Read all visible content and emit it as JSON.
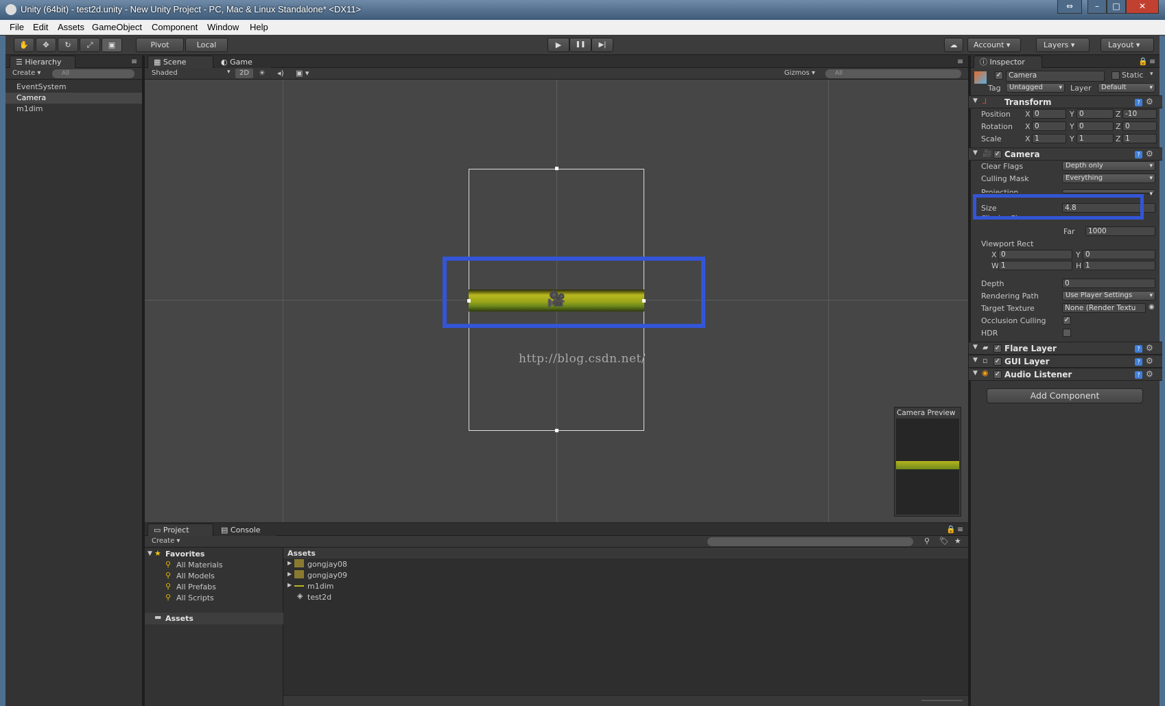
{
  "window": {
    "title": "Unity (64bit) - test2d.unity - New Unity Project - PC, Mac & Linux Standalone* <DX11>",
    "minimize": "–",
    "maximize": "□",
    "close": "✕",
    "restore": "⇔"
  },
  "menu": [
    "File",
    "Edit",
    "Assets",
    "GameObject",
    "Component",
    "Window",
    "Help"
  ],
  "toolbar": {
    "pivot": "Pivot",
    "local": "Local",
    "account": "Account",
    "layers": "Layers",
    "layout": "Layout",
    "play": "▶",
    "pause": "❚❚",
    "step": "▶|"
  },
  "hierarchy": {
    "tab": "Hierarchy",
    "create": "Create",
    "search": "All",
    "items": [
      "EventSystem",
      "Camera",
      "m1dim"
    ],
    "selected": "Camera"
  },
  "scene": {
    "tab_scene": "Scene",
    "tab_game": "Game",
    "shading": "Shaded",
    "mode_2d": "2D",
    "gizmos": "Gizmos",
    "search": "All",
    "watermark": "http://blog.csdn.net/",
    "camera_preview": "Camera Preview"
  },
  "project": {
    "tab_project": "Project",
    "tab_console": "Console",
    "create": "Create",
    "favorites_label": "Favorites",
    "favorites": [
      "All Materials",
      "All Models",
      "All Prefabs",
      "All Scripts"
    ],
    "assets_folder": "Assets",
    "assets_header": "Assets",
    "assets": [
      "gongjay08",
      "gongjay09",
      "m1dim",
      "test2d"
    ]
  },
  "inspector": {
    "tab": "Inspector",
    "object_name": "Camera",
    "static_label": "Static",
    "tag_label": "Tag",
    "tag_value": "Untagged",
    "layer_label": "Layer",
    "layer_value": "Default",
    "transform": {
      "title": "Transform",
      "rows": [
        {
          "label": "Position",
          "x": "0",
          "y": "0",
          "z": "-10"
        },
        {
          "label": "Rotation",
          "x": "0",
          "y": "0",
          "z": "0"
        },
        {
          "label": "Scale",
          "x": "1",
          "y": "1",
          "z": "1"
        }
      ]
    },
    "camera": {
      "title": "Camera",
      "clear_flags_label": "Clear Flags",
      "clear_flags": "Depth only",
      "culling_mask_label": "Culling Mask",
      "culling_mask": "Everything",
      "projection_label": "Projection",
      "size_label": "Size",
      "size": "4.8",
      "clipping_label": "Clipping Planes",
      "far_label": "Far",
      "far": "1000",
      "viewport_label": "Viewport Rect",
      "vx": "0",
      "vy": "0",
      "vw": "1",
      "vh": "1",
      "depth_label": "Depth",
      "depth": "0",
      "rendering_path_label": "Rendering Path",
      "rendering_path": "Use Player Settings",
      "target_texture_label": "Target Texture",
      "target_texture": "None (Render Textu",
      "occlusion_label": "Occlusion Culling",
      "hdr_label": "HDR"
    },
    "flare": "Flare Layer",
    "gui": "GUI Layer",
    "audio": "Audio Listener",
    "add_component": "Add Component"
  },
  "colors": {
    "highlight": "#3355d6",
    "bg": "#2b2b2b"
  }
}
